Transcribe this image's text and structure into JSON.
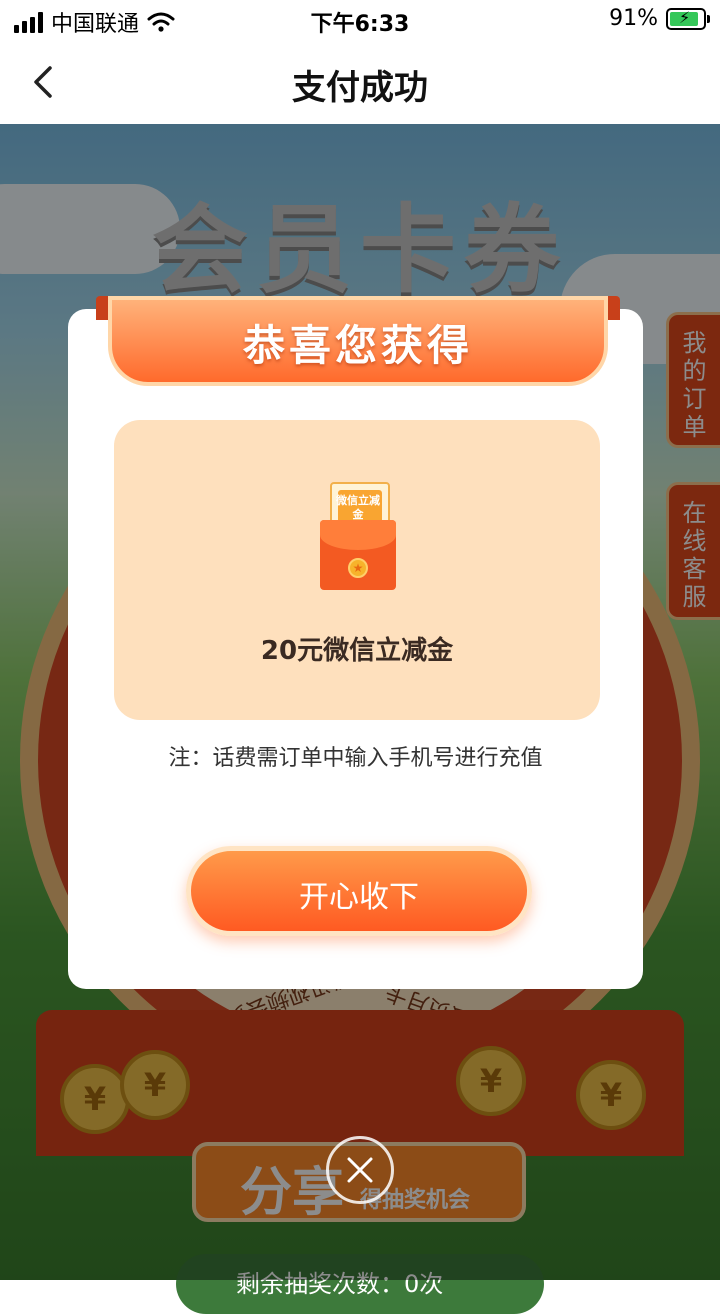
{
  "status_bar": {
    "carrier": "中国联通",
    "time": "下午6:33",
    "battery": "91%"
  },
  "nav": {
    "title": "支付成功",
    "back_icon": "chevron-left-icon"
  },
  "background": {
    "hero_title": "会员卡券",
    "wheel_item_1": "腾讯视频会员月卡",
    "wheel_item_2": "爱奇艺黄金会员月卡",
    "share_big": "分享",
    "share_small": "得抽奖机会",
    "remain_text": "剩余抽奖次数：0次",
    "side_tabs": [
      "我的订单",
      "在线客服"
    ]
  },
  "modal": {
    "header": "恭喜您获得",
    "envelope_label": "微信立减金",
    "prize_name": "20元微信立减金",
    "note": "注：话费需订单中输入手机号进行充值",
    "accept_button": "开心收下",
    "close_icon": "close-icon"
  },
  "colors": {
    "accent": "#ff6a2c",
    "card_bg": "#fee0bd",
    "overlay": "rgba(0,0,0,0.45)"
  }
}
